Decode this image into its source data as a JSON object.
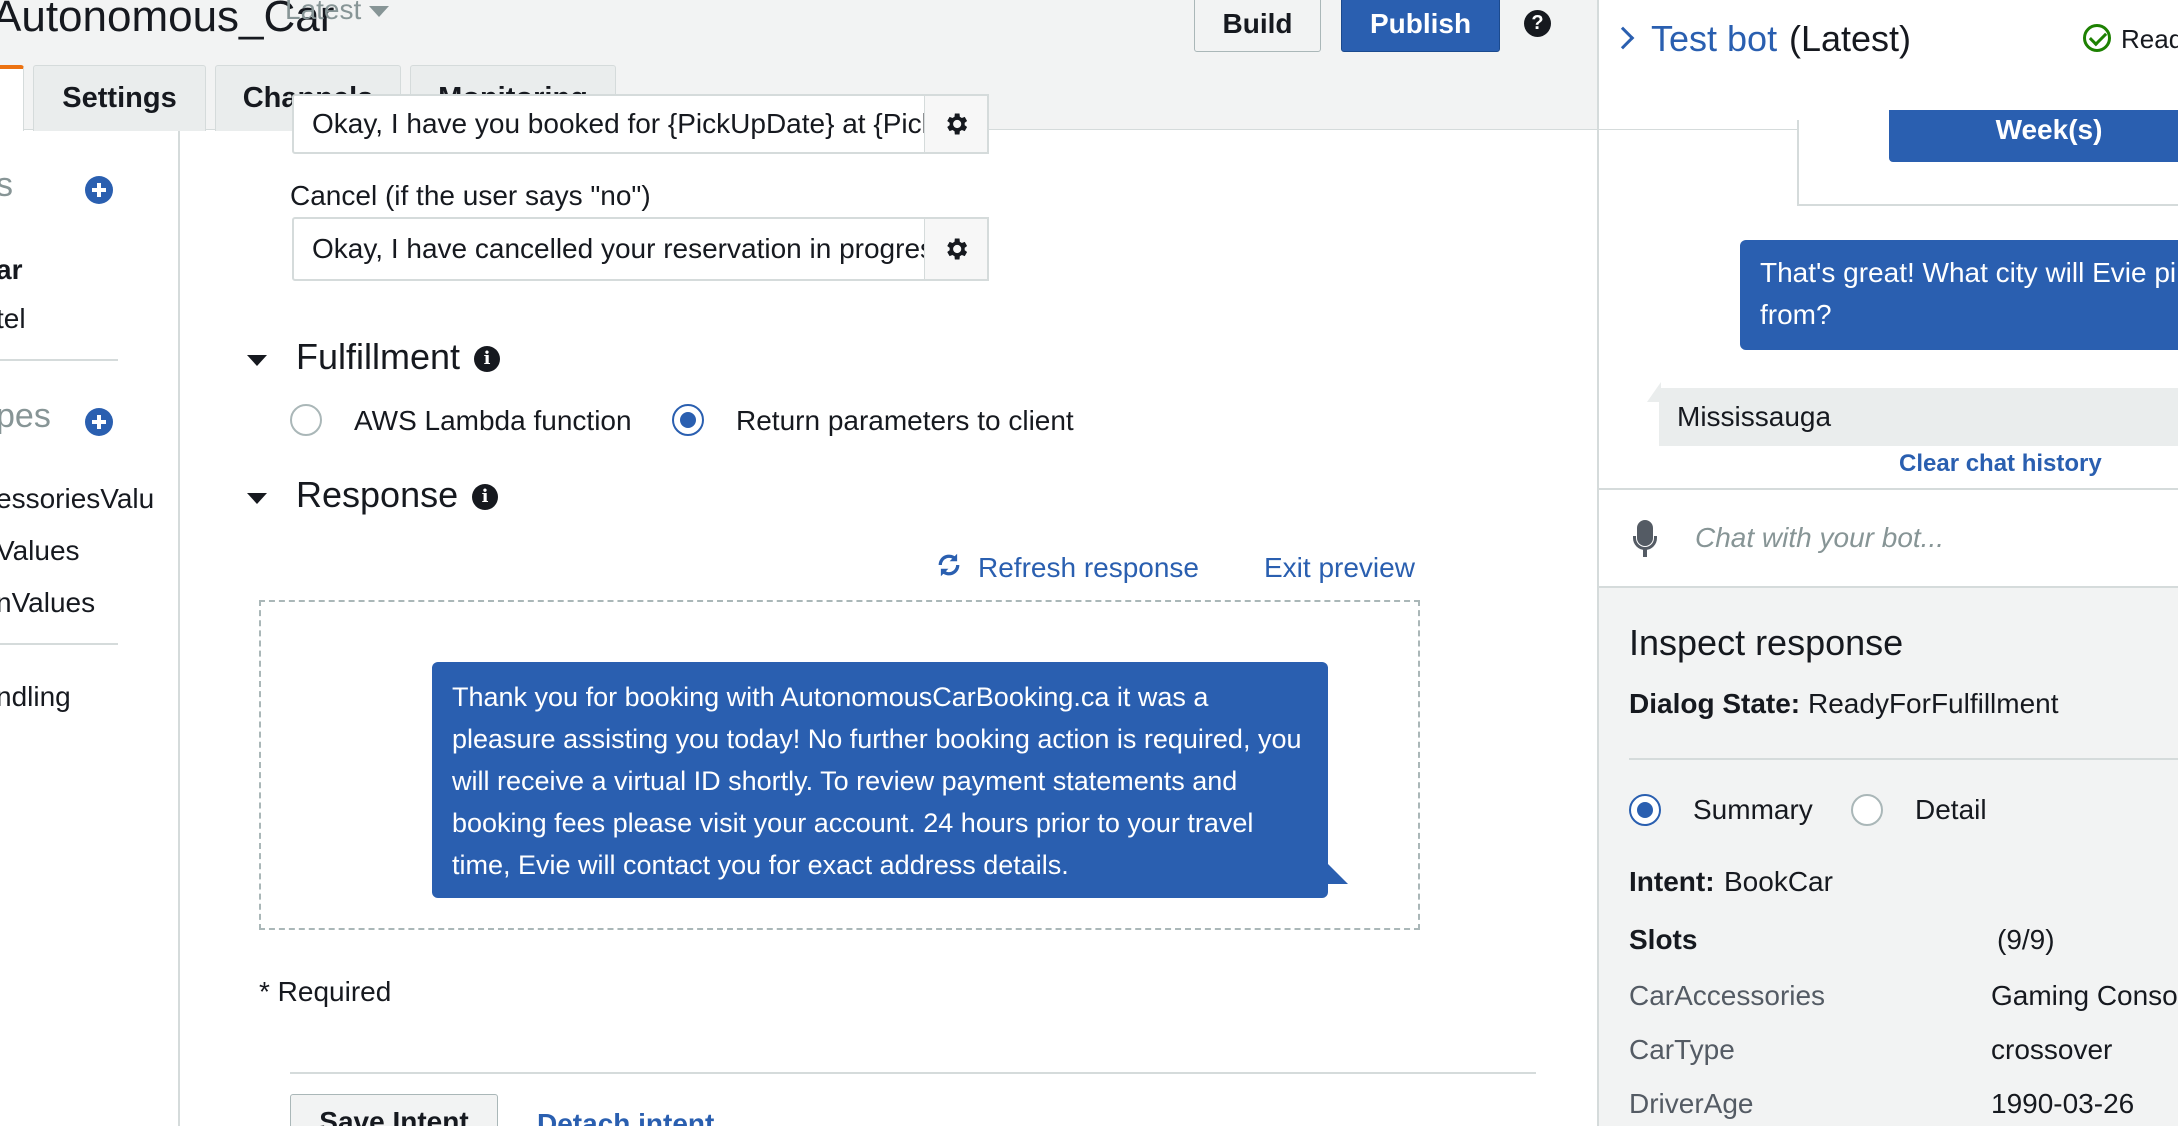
{
  "header": {
    "bot_name": "Autonomous_Car",
    "version": "Latest",
    "build_label": "Build",
    "publish_label": "Publish",
    "help_glyph": "?"
  },
  "tabs": [
    {
      "label": ""
    },
    {
      "label": "Settings"
    },
    {
      "label": "Channels"
    },
    {
      "label": "Monitoring"
    }
  ],
  "sidebar": {
    "intents_heading": "s",
    "intents": [
      "ar",
      "tel"
    ],
    "slot_types_heading": "pes",
    "slot_types": [
      "essoriesValu",
      "Values",
      "nValues"
    ],
    "error_handling": "ndling"
  },
  "confirmation": {
    "confirm_value": "Okay, I have you booked for {PickUpDate} at {PickUpTime}",
    "cancel_label": "Cancel (if the user says \"no\")",
    "cancel_value": "Okay, I have cancelled your reservation in progress"
  },
  "fulfillment": {
    "heading": "Fulfillment",
    "option_lambda": "AWS Lambda function",
    "option_return": "Return parameters to client",
    "selected": "Return parameters to client"
  },
  "response": {
    "heading": "Response",
    "refresh_label": "Refresh response",
    "exit_label": "Exit preview",
    "message": "Thank you for booking with AutonomousCarBooking.ca it was a pleasure assisting you today! No further booking action is required, you will receive a virtual ID shortly. To review payment statements and booking fees please visit your account. 24 hours prior to your travel time, Evie will contact you for exact address details."
  },
  "footer": {
    "required_note": "* Required",
    "save_label": "Save Intent",
    "detach_label": "Detach intent"
  },
  "test_panel": {
    "title": "Test bot",
    "version": "(Latest)",
    "status": "Read",
    "card_button": "Week(s)",
    "bot_message": "That's great! What city will Evie pi from?",
    "user_message": "Mississauga",
    "clear_label": "Clear chat history",
    "chat_placeholder": "Chat with your bot..."
  },
  "inspect": {
    "heading": "Inspect response",
    "dialog_state_label": "Dialog State:",
    "dialog_state_value": "ReadyForFulfillment",
    "view_summary": "Summary",
    "view_detail": "Detail",
    "intent_label": "Intent:",
    "intent_value": "BookCar",
    "slots_label": "Slots",
    "slots_count": "(9/9)",
    "slots": [
      {
        "name": "CarAccessories",
        "value": "Gaming Conso"
      },
      {
        "name": "CarType",
        "value": "crossover"
      },
      {
        "name": "DriverAge",
        "value": "1990-03-26"
      }
    ]
  },
  "colors": {
    "accent_blue": "#2a5fb0",
    "tab_orange": "#ec7211",
    "status_green": "#1d8102"
  }
}
